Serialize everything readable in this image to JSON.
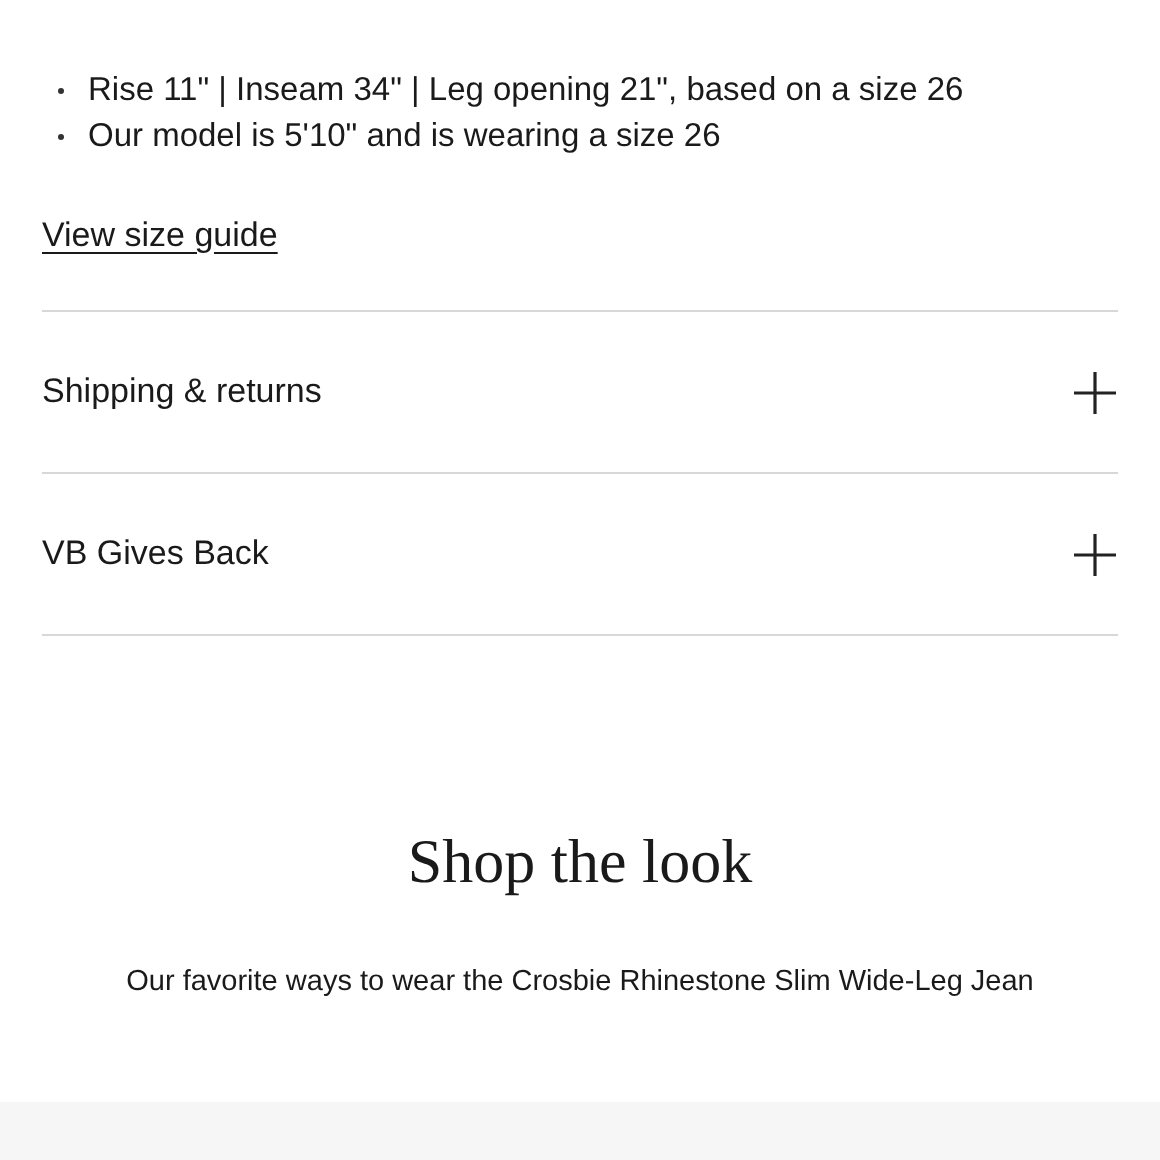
{
  "details": [
    "Rise 11\" | Inseam 34\" | Leg opening 21\", based on a size 26",
    "Our model is 5'10\" and is wearing a size 26"
  ],
  "size_guide_link": "View size guide",
  "accordion": [
    {
      "title": "Shipping & returns",
      "expanded": false
    },
    {
      "title": "VB Gives Back",
      "expanded": false
    }
  ],
  "shop_the_look": {
    "heading": "Shop the look",
    "subtitle": "Our favorite ways to wear the Crosbie Rhinestone Slim Wide-Leg Jean"
  }
}
